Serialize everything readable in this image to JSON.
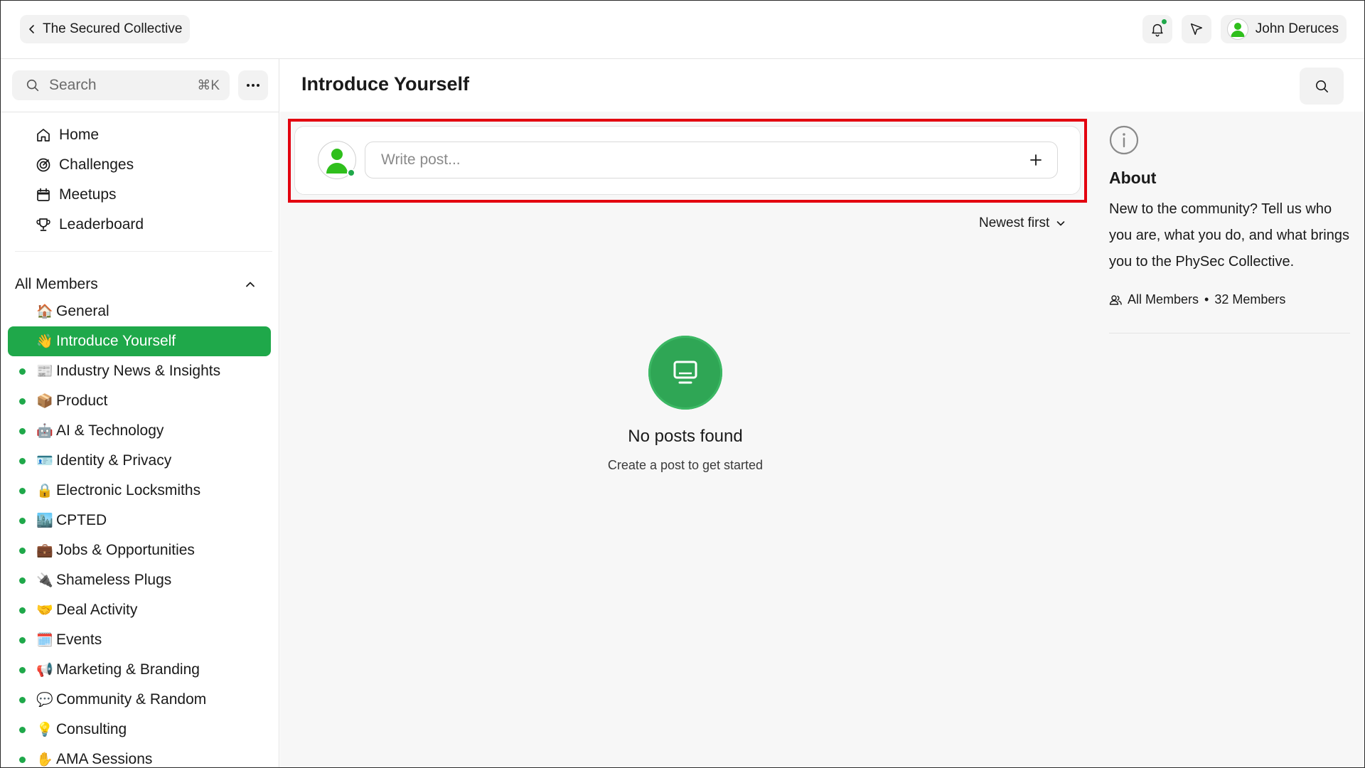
{
  "header": {
    "back_label": "The Secured Collective",
    "user_name": "John Deruces"
  },
  "sidebar": {
    "search_placeholder": "Search",
    "search_shortcut": "⌘K",
    "nav": [
      {
        "label": "Home",
        "icon": "home-icon"
      },
      {
        "label": "Challenges",
        "icon": "target-icon"
      },
      {
        "label": "Meetups",
        "icon": "calendar-icon"
      },
      {
        "label": "Leaderboard",
        "icon": "trophy-icon"
      }
    ],
    "section_title": "All Members",
    "channels": [
      {
        "emoji": "🏠",
        "label": "General",
        "unread": false,
        "active": false
      },
      {
        "emoji": "👋",
        "label": "Introduce Yourself",
        "unread": false,
        "active": true
      },
      {
        "emoji": "📰",
        "label": "Industry News & Insights",
        "unread": true,
        "active": false
      },
      {
        "emoji": "📦",
        "label": "Product",
        "unread": true,
        "active": false
      },
      {
        "emoji": "🤖",
        "label": "AI & Technology",
        "unread": true,
        "active": false
      },
      {
        "emoji": "🪪",
        "label": "Identity & Privacy",
        "unread": true,
        "active": false
      },
      {
        "emoji": "🔒",
        "label": "Electronic Locksmiths",
        "unread": true,
        "active": false
      },
      {
        "emoji": "🏙️",
        "label": "CPTED",
        "unread": true,
        "active": false
      },
      {
        "emoji": "💼",
        "label": "Jobs & Opportunities",
        "unread": true,
        "active": false
      },
      {
        "emoji": "🔌",
        "label": "Shameless Plugs",
        "unread": true,
        "active": false
      },
      {
        "emoji": "🤝",
        "label": "Deal Activity",
        "unread": true,
        "active": false
      },
      {
        "emoji": "🗓️",
        "label": "Events",
        "unread": true,
        "active": false
      },
      {
        "emoji": "📢",
        "label": "Marketing & Branding",
        "unread": true,
        "active": false
      },
      {
        "emoji": "💬",
        "label": "Community & Random",
        "unread": true,
        "active": false
      },
      {
        "emoji": "💡",
        "label": "Consulting",
        "unread": true,
        "active": false
      },
      {
        "emoji": "✋",
        "label": "AMA Sessions",
        "unread": true,
        "active": false
      }
    ]
  },
  "main": {
    "title": "Introduce Yourself",
    "composer_placeholder": "Write post...",
    "sort_label": "Newest first",
    "empty_title": "No posts found",
    "empty_subtitle": "Create a post to get started"
  },
  "about": {
    "title": "About",
    "text": "New to the community? Tell us who you are, what you do, and what brings you to the PhySec Collective.",
    "group": "All Members",
    "members": "32 Members"
  },
  "colors": {
    "accent": "#1fa84a",
    "highlight": "#e3000f"
  }
}
